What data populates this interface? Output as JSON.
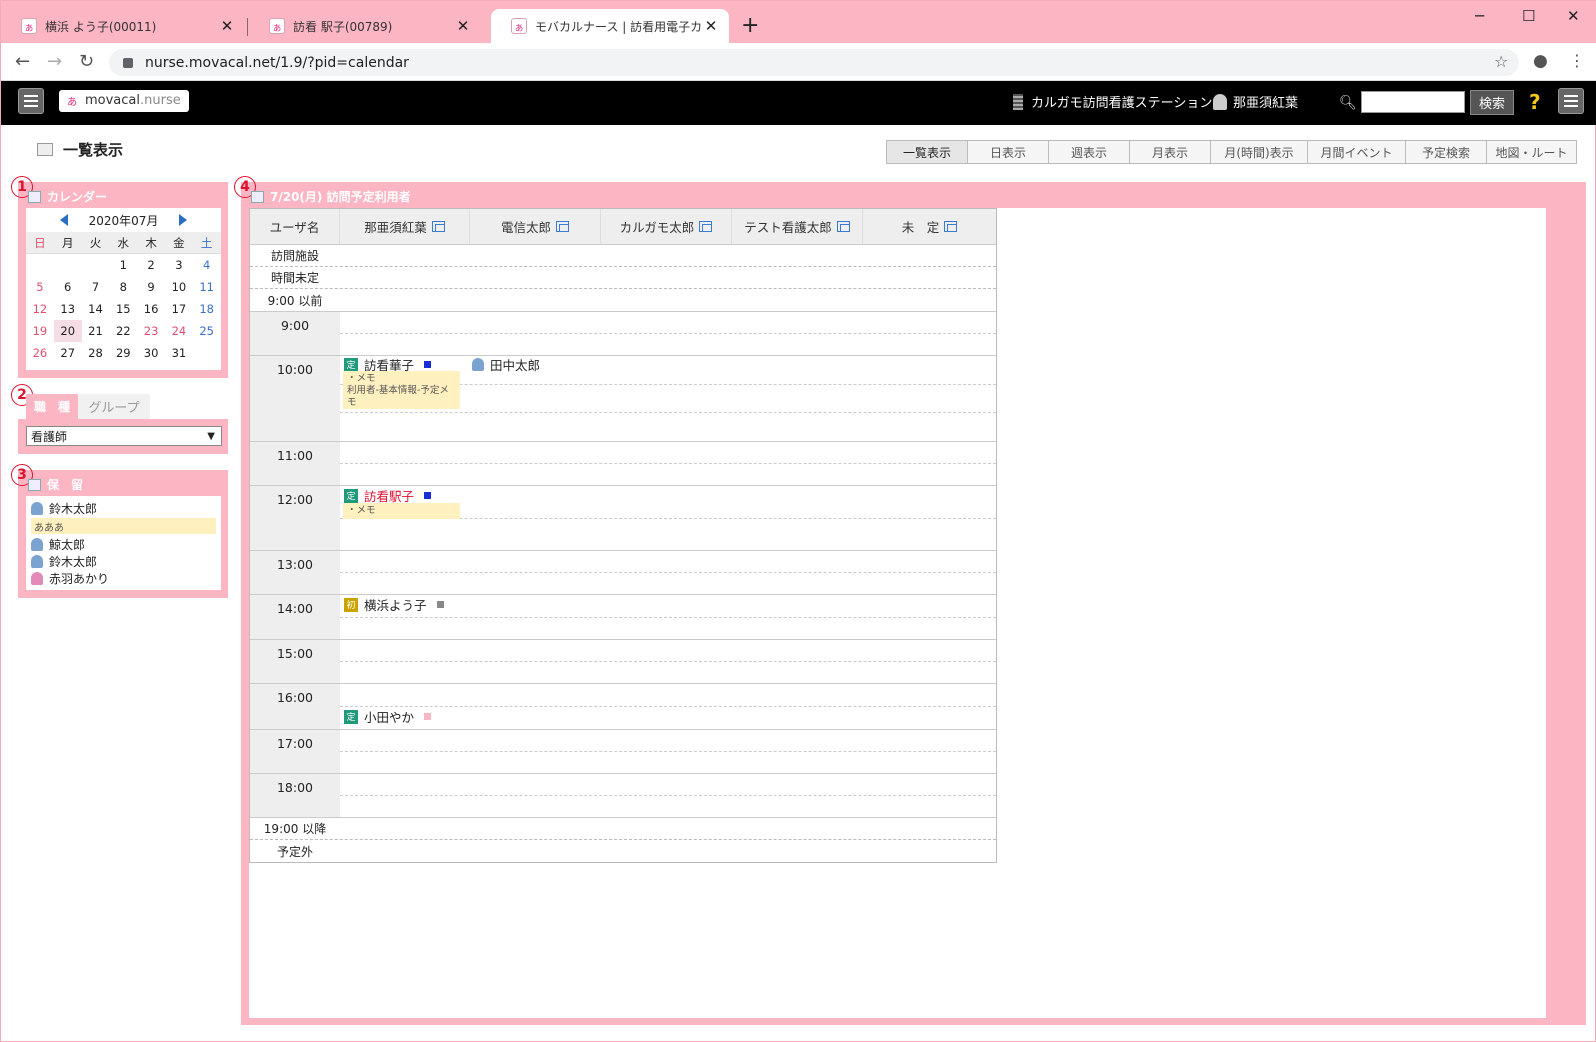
{
  "browser": {
    "tabs": [
      {
        "title": "横浜 よう子(00011)"
      },
      {
        "title": "訪看 駅子(00789)"
      },
      {
        "title": "モバカルナース | 訪看用電子カルテ"
      }
    ],
    "new_tab": "+",
    "url": "nurse.movacal.net/1.9/?pid=calendar"
  },
  "app": {
    "logo_main": "movacal",
    "logo_sub": ".nurse",
    "station": "カルガモ訪問看護ステーション",
    "user": "那亜須紅葉",
    "search_btn": "検索",
    "help": "?"
  },
  "page": {
    "title": "一覧表示",
    "view_tabs": [
      "一覧表示",
      "日表示",
      "週表示",
      "月表示",
      "月(時間)表示",
      "月間イベント",
      "予定検索",
      "地図・ルート"
    ]
  },
  "panels": {
    "n1": "1",
    "n2": "2",
    "n3": "3",
    "n4": "4"
  },
  "calendar": {
    "header": "カレンダー",
    "month": "2020年07月",
    "weekdays": [
      "日",
      "月",
      "火",
      "水",
      "木",
      "金",
      "土"
    ],
    "weeks": [
      [
        "",
        "",
        "",
        "1",
        "2",
        "3",
        "4"
      ],
      [
        "5",
        "6",
        "7",
        "8",
        "9",
        "10",
        "11"
      ],
      [
        "12",
        "13",
        "14",
        "15",
        "16",
        "17",
        "18"
      ],
      [
        "19",
        "20",
        "21",
        "22",
        "23",
        "24",
        "25"
      ],
      [
        "26",
        "27",
        "28",
        "29",
        "30",
        "31",
        ""
      ]
    ],
    "holidays": [
      "23",
      "24"
    ],
    "today": "20"
  },
  "shokushu": {
    "tab_a": "職　種",
    "tab_b": "グループ",
    "selected": "看護師"
  },
  "holding": {
    "header": "保　留",
    "items": [
      {
        "name": "鈴木太郎",
        "gender": "m",
        "memo": "あああ"
      },
      {
        "name": "鯨太郎",
        "gender": "m"
      },
      {
        "name": "鈴木太郎",
        "gender": "m"
      },
      {
        "name": "赤羽あかり",
        "gender": "f"
      }
    ]
  },
  "schedule": {
    "header": "7/20(月) 訪問予定利用者",
    "col0": "ユーザ名",
    "staff": [
      "那亜須紅葉",
      "電信太郎",
      "カルガモ太郎",
      "テスト看護太郎",
      "未　定"
    ],
    "pre_rows": [
      "訪問施設",
      "時間未定",
      "9:00 以前"
    ],
    "hours": [
      "9:00",
      "10:00",
      "11:00",
      "12:00",
      "13:00",
      "14:00",
      "15:00",
      "16:00",
      "17:00",
      "18:00"
    ],
    "post_rows": [
      "19:00 以降",
      "予定外"
    ],
    "events": [
      {
        "badge": "定",
        "name": "訪看華子",
        "sq": "#1a2fd6",
        "memo": "・メモ\n利用者-基本情報-予定メモ"
      },
      {
        "name": "田中太郎"
      },
      {
        "badge": "定",
        "name": "訪看駅子",
        "sq": "#1a2fd6",
        "memo": "・メモ",
        "color": "#e0102f"
      },
      {
        "badge": "初",
        "name": "横浜よう子",
        "sq": "#888888"
      },
      {
        "badge": "定",
        "name": "小田やか",
        "sq": "#f7b7c7"
      }
    ]
  },
  "colors": {
    "accent": "#fbb5c3",
    "header_bg": "#000000"
  }
}
